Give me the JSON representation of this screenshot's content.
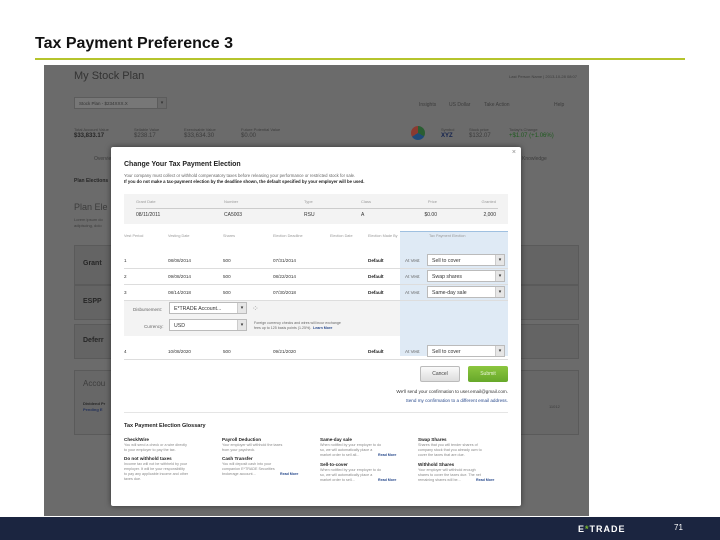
{
  "slide": {
    "title": "Tax Payment Preference 3",
    "page_number": "71",
    "logo": "E*TRADE"
  },
  "app": {
    "title": "My Stock Plan",
    "user": "Last Person Name | 2013-10-28 08:07",
    "plan_select": "Stock Plan - $234XXX.X",
    "menu": [
      "Insights",
      "US Dollar",
      "Take Action",
      "Help"
    ],
    "summary": [
      {
        "label": "Total Account Value",
        "value": "$33,833.17"
      },
      {
        "label": "Sellable Value",
        "value": "$238.17"
      },
      {
        "label": "Exercisable Value",
        "value": "$33,634.30"
      },
      {
        "label": "Future Potential Value",
        "value": "$0.00"
      }
    ],
    "quote": {
      "symbol_label": "Symbol",
      "symbol": "XYZ",
      "price_label": "Stock price",
      "price": "$132.07",
      "change_label": "Today's Change",
      "change": "+$1.07 (+1.06%)"
    },
    "bg": {
      "tab": "Overview",
      "tab_right": "Knowledge",
      "section": "Plan Elections",
      "heading": "Plan Ele",
      "desc1": "Lorem ipsum do",
      "desc2": "adipiscing, dolo",
      "cards": [
        "Grant",
        "ESPP",
        "Deferr"
      ],
      "account": "Accou",
      "acct1": "Dividend Pr",
      "acct2": "Pending E",
      "acct_num": "11012"
    },
    "colors": {
      "accent_green": "#7ab82e",
      "footer": "#1b2540",
      "rule": "#b5c42c",
      "election_col": "#dfeaf5"
    }
  },
  "modal": {
    "title": "Change Your Tax Payment Election",
    "intro": "Your company must collect or withhold compensatory taxes before releasing your performance or restricted stock for sale.",
    "intro_bold": "If you do not make a tax-payment election by the deadline shown, the default specified by your employer will be used.",
    "grant": {
      "headers": [
        "Grant Date",
        "Number",
        "Type",
        "Class",
        "Price",
        "Granted"
      ],
      "values": [
        "08/11/2011",
        "CA5003",
        "RSU",
        "A",
        "$0.00",
        "2,000"
      ]
    },
    "vest": {
      "headers": [
        "Vest Period",
        "Vesting Date",
        "Shares",
        "Election Deadline",
        "Election Date",
        "Election Made By",
        "Tax Payment Election"
      ],
      "rows": [
        {
          "period": "1",
          "date": "08/08/2014",
          "shares": "500",
          "deadline": "07/31/2014",
          "made_by": "Default",
          "at": "At Vest",
          "election": "Sell to cover"
        },
        {
          "period": "2",
          "date": "09/08/2014",
          "shares": "500",
          "deadline": "08/22/2014",
          "made_by": "Default",
          "at": "At Vest",
          "election": "Swap shares"
        },
        {
          "period": "3",
          "date": "08/14/2018",
          "shares": "500",
          "deadline": "07/30/2018",
          "made_by": "Default",
          "at": "At Vest",
          "election": "Same-day sale"
        },
        {
          "period": "4",
          "date": "10/08/2020",
          "shares": "500",
          "deadline": "09/21/2020",
          "made_by": "Default",
          "at": "At Vest",
          "election": "Sell to cover"
        }
      ]
    },
    "disbursement": {
      "label": "Disbursement:",
      "value": "E*TRADE Account...",
      "currency_label": "Currency:",
      "currency": "USD",
      "note1": "Foreign currency checks and wires will incur exchange",
      "note2": "fees up to 125 basis points (1.25%).",
      "learn_more": "Learn More"
    },
    "cancel": "Cancel",
    "submit": "Submit",
    "confirm": "We'll send your confirmation to user.email@gmail.com.",
    "confirm_link": "Send my confirmation to a different email address.",
    "close": "×",
    "glossary": {
      "title": "Tax Payment Election Glossary",
      "read_more": "Read More",
      "items": [
        {
          "term": "Check/Wire",
          "l1": "You will send a check or a wire directly",
          "l2": "to your employer to pay the tax."
        },
        {
          "term": "Do not withhold taxes",
          "l1": "Income tax will not be withheld by your",
          "l2": "employer. It will be your responsibility",
          "l3": "to pay any applicable income and other",
          "l4": "taxes due."
        },
        {
          "term": "Payroll Deduction",
          "l1": "Your employer will withhold the taxes",
          "l2": "from your paycheck."
        },
        {
          "term": "Cash Transfer",
          "l1": "You will deposit cash into your",
          "l2": "companion E*TRADE Securities",
          "l3": "brokerage account..."
        },
        {
          "term": "Same-day sale",
          "l1": "When notified by your employer to do",
          "l2": "so, we will automatically place a",
          "l3": "market order to sell all..."
        },
        {
          "term": "Sell-to-cover",
          "l1": "When notified by your employer to do",
          "l2": "so, we will automatically place a",
          "l3": "market order to sell..."
        },
        {
          "term": "Swap Shares",
          "l1": "Shares that you will tender shares of",
          "l2": "company stock that you already own to",
          "l3": "cover the taxes that are due."
        },
        {
          "term": "Withhold Shares",
          "l1": "Your employer will withhold enough",
          "l2": "shares to cover the taxes due. The net",
          "l3": "remaining shares will be..."
        }
      ]
    }
  }
}
